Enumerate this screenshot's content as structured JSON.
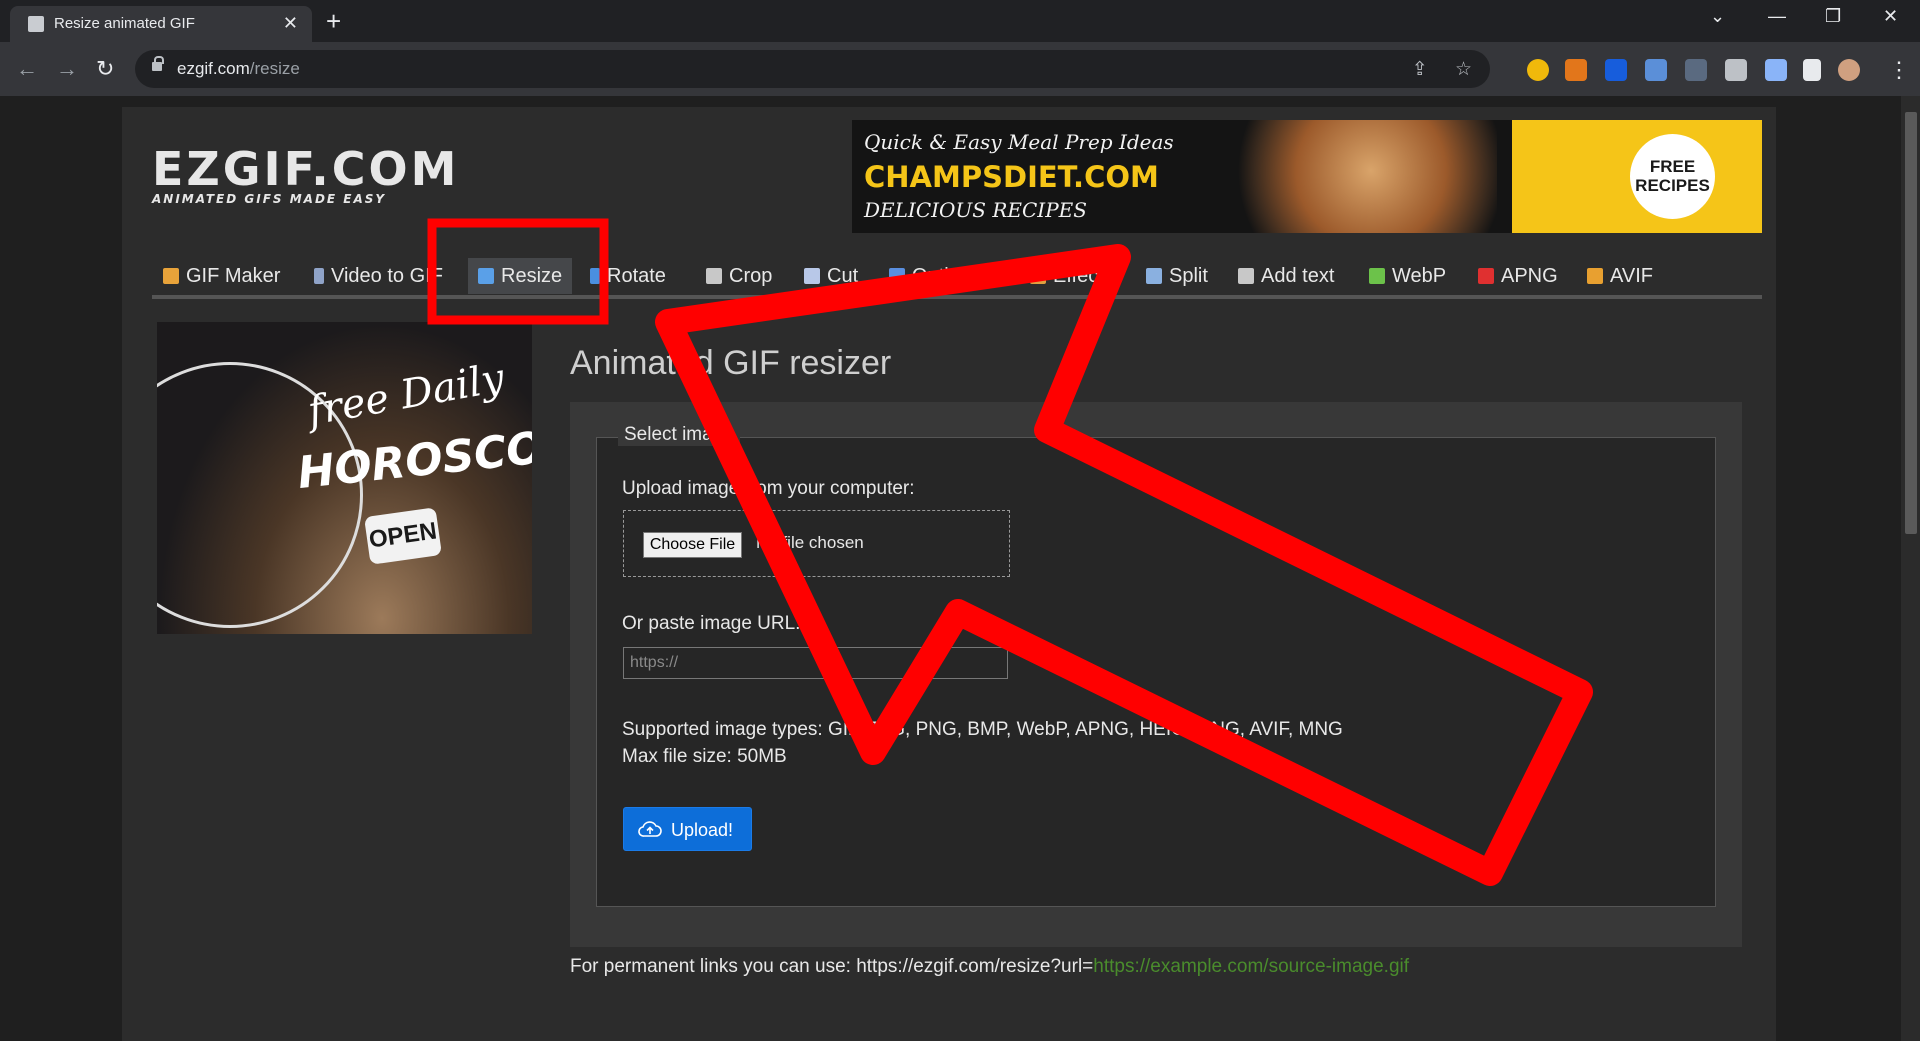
{
  "browser": {
    "tab_title": "Resize animated GIF",
    "tab_close": "✕",
    "new_tab": "+",
    "url_domain": "ezgif.com",
    "url_path": "/resize",
    "window_controls": {
      "dropdown": "⌄",
      "minimize": "—",
      "restore": "❐",
      "close": "✕"
    },
    "nav": {
      "back": "←",
      "forward": "→",
      "reload": "↻"
    },
    "omni_icons": {
      "share": "⇪",
      "bookmark": "☆"
    },
    "menu": "⋮"
  },
  "site": {
    "logo_main": "EZGIF.COM",
    "logo_tagline": "ANIMATED GIFS MADE EASY",
    "top_ad": {
      "line1": "Quick & Easy Meal Prep Ideas",
      "line2": "CHAMPSDIET.COM",
      "line3": "DELICIOUS RECIPES",
      "badge": "FREE RECIPES"
    },
    "nav_items": [
      {
        "label": "GIF Maker",
        "icon": "gif-maker-icon",
        "color": "#e8a33a"
      },
      {
        "label": "Video to GIF",
        "icon": "video-icon",
        "color": "#8fa3c8"
      },
      {
        "label": "Resize",
        "icon": "resize-icon",
        "color": "#5aa0e8"
      },
      {
        "label": "Rotate",
        "icon": "rotate-icon",
        "color": "#4a8fe0"
      },
      {
        "label": "Crop",
        "icon": "crop-icon",
        "color": "#c8c8c8"
      },
      {
        "label": "Cut",
        "icon": "cut-icon",
        "color": "#b8c8e8"
      },
      {
        "label": "Optimize",
        "icon": "optimize-icon",
        "color": "#5a8fe0"
      },
      {
        "label": "Effects",
        "icon": "effects-icon",
        "color": "#e0a040"
      },
      {
        "label": "Split",
        "icon": "split-icon",
        "color": "#8ab0e0"
      },
      {
        "label": "Add text",
        "icon": "add-text-icon",
        "color": "#c8c8c8"
      },
      {
        "label": "WebP",
        "icon": "webp-icon",
        "color": "#6cc24a"
      },
      {
        "label": "APNG",
        "icon": "apng-icon",
        "color": "#e03030"
      },
      {
        "label": "AVIF",
        "icon": "avif-icon",
        "color": "#e8a030"
      }
    ],
    "side_ad": {
      "line1": "free Daily",
      "line2": "HOROSCOPE",
      "button": "OPEN"
    }
  },
  "main": {
    "title": "Animated GIF resizer",
    "legend": "Select image",
    "upload_label": "Upload image from your computer:",
    "choose_file": "Choose File",
    "no_file": "No file chosen",
    "paste_label": "Or paste image URL:",
    "url_placeholder": "https://",
    "supported": "Supported image types: GIF, JPG, PNG, BMP, WebP, APNG, HEIC, MNG, AVIF, MNG",
    "max_size": "Max file size: 50MB",
    "upload_button": "Upload!",
    "permalink_prefix": "For permanent links you can use: https://ezgif.com/resize?url=",
    "permalink_example": "https://example.com/source-image.gif"
  },
  "annotation": {
    "color": "#ff0000"
  }
}
